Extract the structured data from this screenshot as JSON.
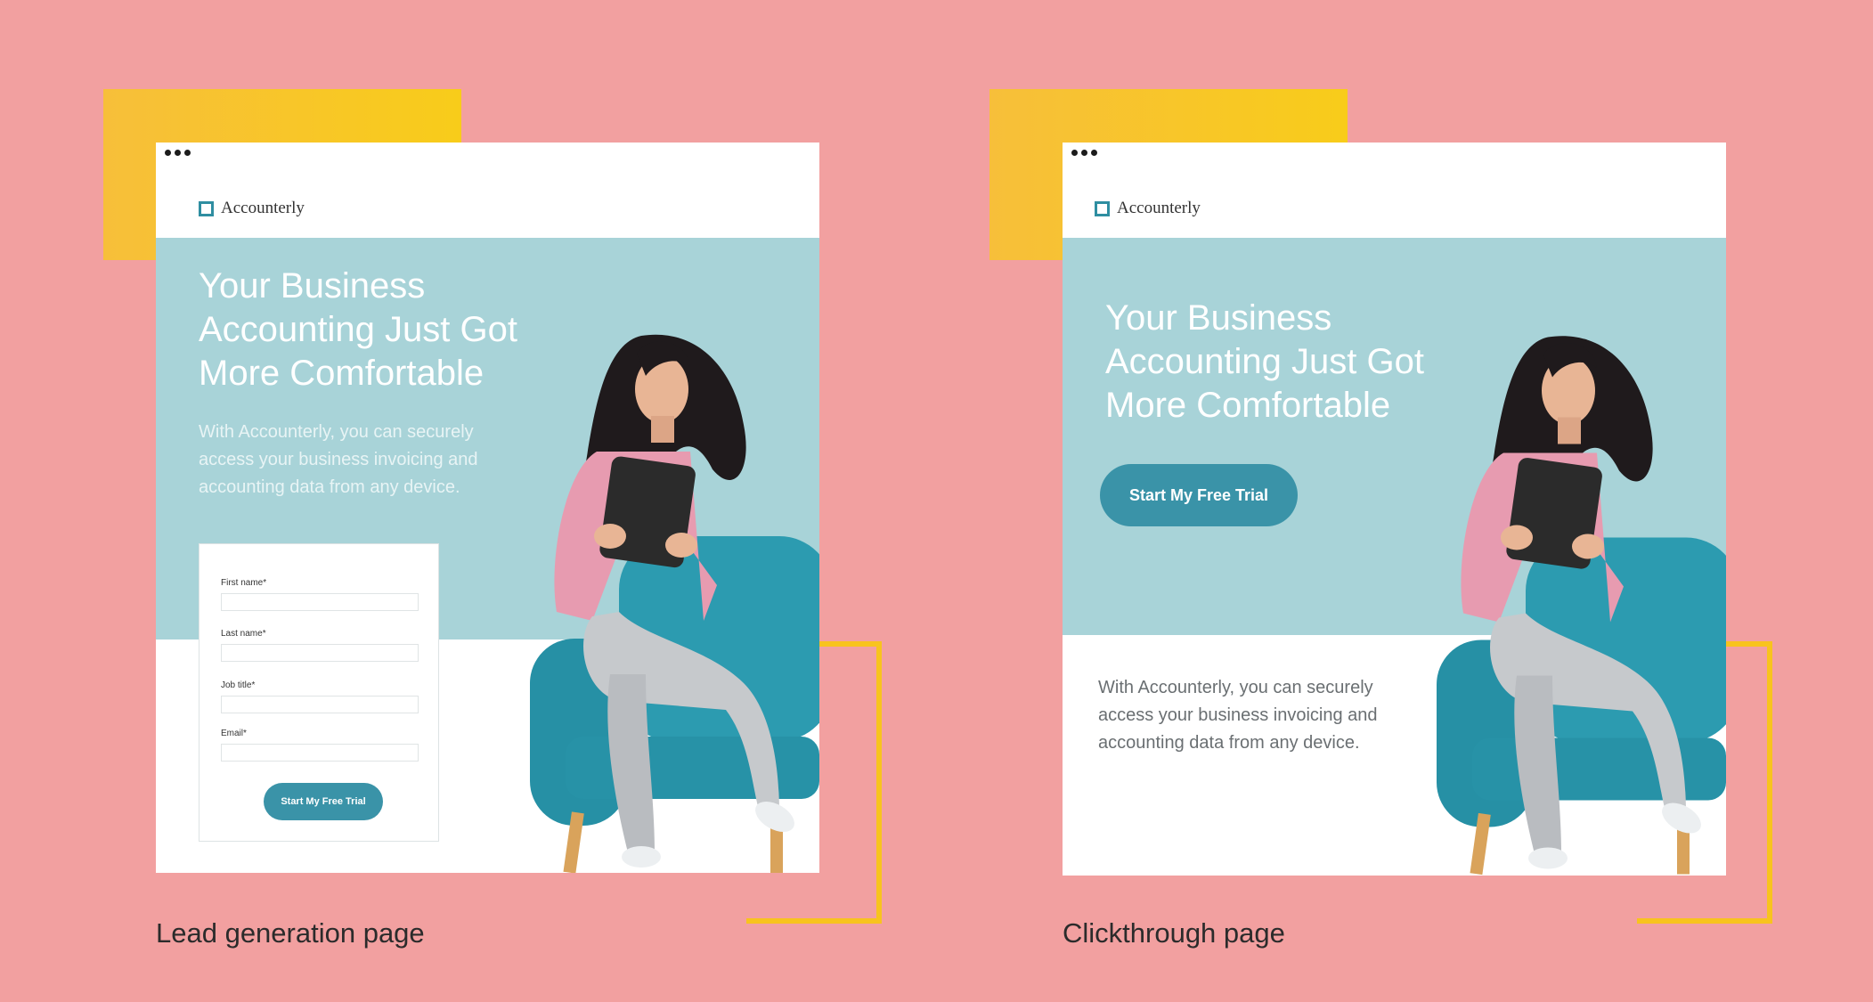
{
  "colors": {
    "background": "#f2a0a0",
    "accent_yellow": "#f8c31e",
    "hero_teal": "#a8d3d8",
    "cta_blue": "#3a93a8",
    "chair_teal": "#2c9bb0"
  },
  "logo": {
    "icon": "square-outline-icon",
    "text": "Accounterly"
  },
  "headline": {
    "line1": "Your Business",
    "line2": "Accounting Just Got",
    "line3": "More Comfortable"
  },
  "body": {
    "line1": "With Accounterly, you can securely",
    "line2": "access your business invoicing and",
    "line3": "accounting data from any device."
  },
  "lead_page": {
    "caption": "Lead generation page",
    "form": {
      "fields": [
        {
          "label": "First name*"
        },
        {
          "label": "Last name*"
        },
        {
          "label": "Job title*"
        },
        {
          "label": "Email*"
        }
      ],
      "submit_label": "Start My Free Trial"
    }
  },
  "click_page": {
    "caption": "Clickthrough page",
    "cta_label": "Start My Free Trial"
  }
}
